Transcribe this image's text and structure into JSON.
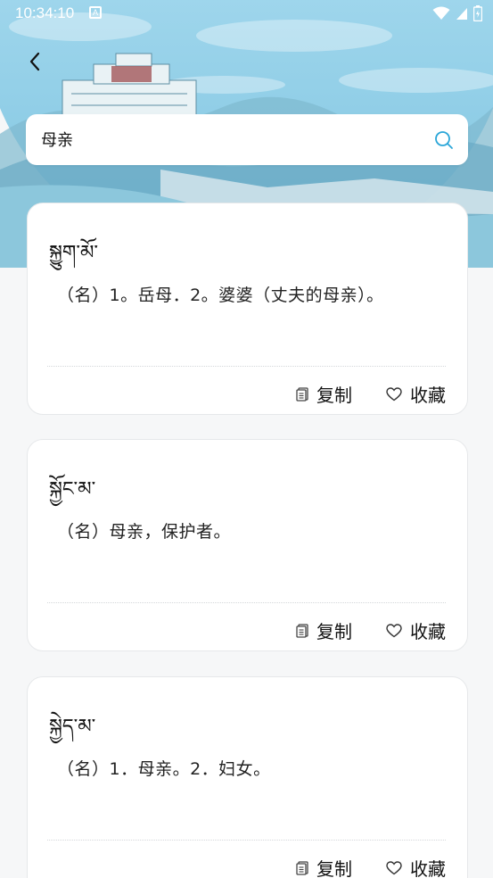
{
  "status_bar": {
    "time": "10:34:10",
    "notification_glyph": "A",
    "icons": [
      "wifi-icon",
      "signal-icon",
      "battery-icon"
    ]
  },
  "header": {
    "back_icon": "chevron-left-icon"
  },
  "search": {
    "value": "母亲",
    "icon": "search-icon"
  },
  "colors": {
    "accent": "#2aa6d8",
    "hero": "#9fd6ec",
    "card_bg": "#ffffff",
    "page_bg": "#f6f7f8"
  },
  "results": [
    {
      "headword": "སྐྱུག་མོ་",
      "definition": "（名）1。岳母．2。婆婆（丈夫的母亲）。",
      "copy_label": "复制",
      "favorite_label": "收藏"
    },
    {
      "headword": "སྐྱོང་མ་",
      "definition": "（名）母亲，保护者。",
      "copy_label": "复制",
      "favorite_label": "收藏"
    },
    {
      "headword": "སྐྱེད་མ་",
      "definition": "（名）1．母亲。2．妇女。",
      "copy_label": "复制",
      "favorite_label": "收藏"
    }
  ]
}
